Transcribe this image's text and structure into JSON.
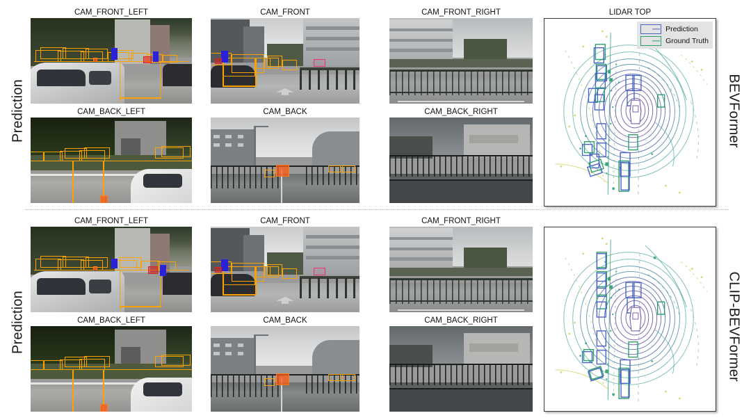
{
  "figure": {
    "rows": [
      {
        "id": "row-bevformer",
        "left_label": "Prediction",
        "right_label": "BEVFormer",
        "cameras_front": [
          {
            "name": "CAM_FRONT_LEFT"
          },
          {
            "name": "CAM_FRONT"
          },
          {
            "name": "CAM_FRONT_RIGHT"
          }
        ],
        "cameras_back": [
          {
            "name": "CAM_BACK_LEFT"
          },
          {
            "name": "CAM_BACK"
          },
          {
            "name": "CAM_BACK_RIGHT"
          }
        ],
        "lidar": {
          "title": "LIDAR TOP",
          "show_legend": true,
          "legend": [
            {
              "label": "Prediction",
              "color": "#4a63c8"
            },
            {
              "label": "Ground Truth",
              "color": "#2aa06a"
            }
          ]
        }
      },
      {
        "id": "row-clip-bevformer",
        "left_label": "Prediction",
        "right_label": "CLIP-BEVFormer",
        "cameras_front": [
          {
            "name": "CAM_FRONT_LEFT"
          },
          {
            "name": "CAM_FRONT"
          },
          {
            "name": "CAM_FRONT_RIGHT"
          }
        ],
        "cameras_back": [
          {
            "name": "CAM_BACK_LEFT"
          },
          {
            "name": "CAM_BACK"
          },
          {
            "name": "CAM_BACK_RIGHT"
          }
        ],
        "lidar": {
          "title": "",
          "show_legend": false,
          "legend": []
        }
      }
    ],
    "colors": {
      "prediction_box": "#4a63c8",
      "ground_truth_box": "#2aa06a",
      "camera_box_car": "#FFA200",
      "camera_box_pedestrian": "#2a22d8",
      "camera_box_barrier": "#e8327c",
      "camera_box_truck": "#e02020",
      "legend_background": "#e3e3e3",
      "panel_border": "#3a3a3a",
      "divider": "#b8b8b8"
    }
  }
}
